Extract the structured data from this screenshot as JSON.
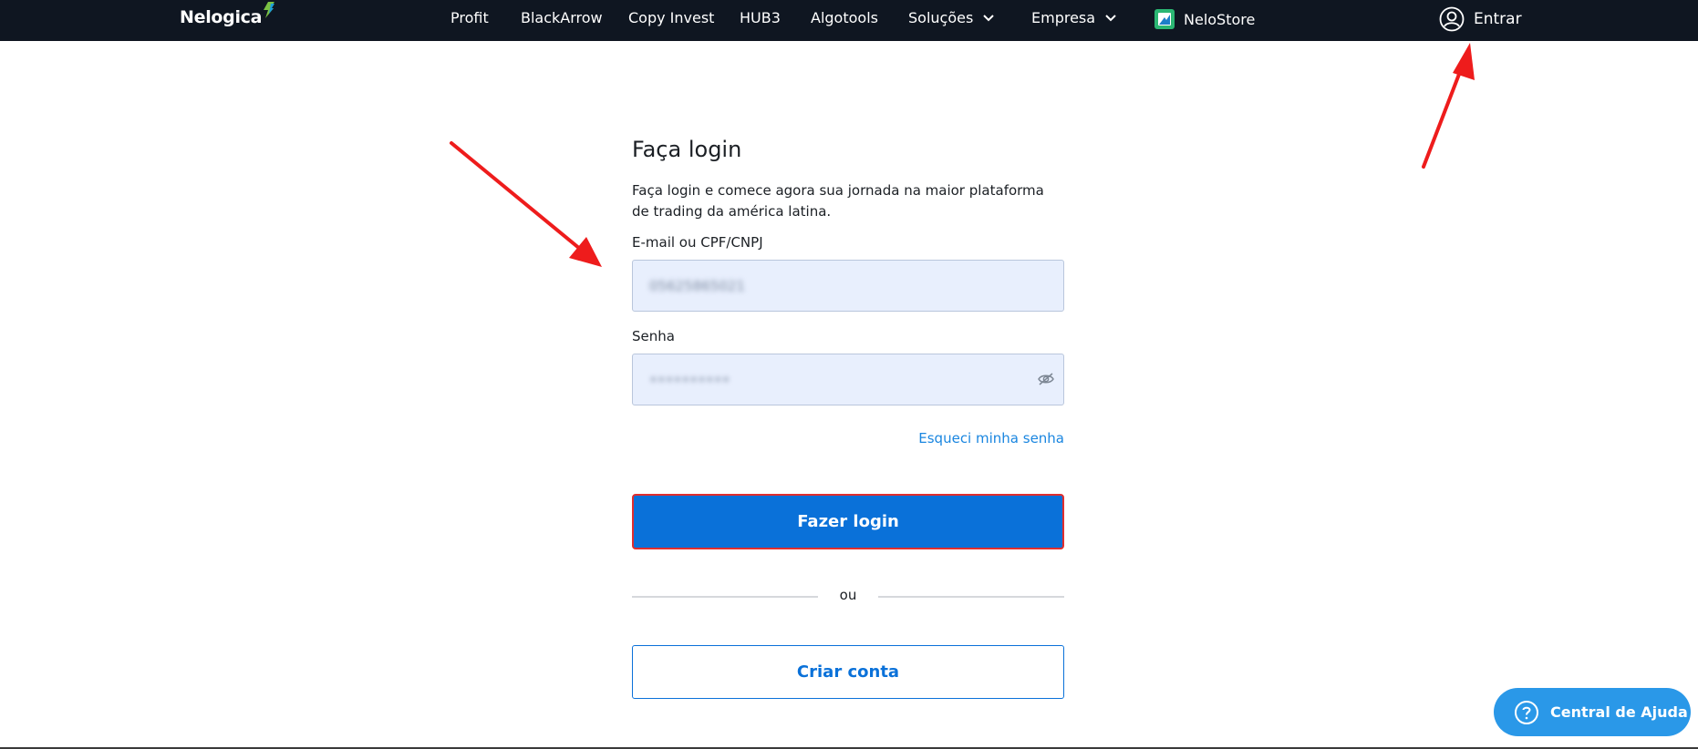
{
  "topbar": {
    "brand": "Nelogica",
    "nav": {
      "profit": "Profit",
      "blackarrow": "BlackArrow",
      "copy_invest": "Copy Invest",
      "hub3": "HUB3",
      "algotools": "Algotools",
      "solucoes": "Soluções",
      "empresa": "Empresa",
      "nelostore": "NeloStore"
    },
    "login_link": "Entrar"
  },
  "login": {
    "title": "Faça login",
    "subtitle": "Faça login e comece agora sua jornada na maior plataforma de trading da américa latina.",
    "email_label": "E-mail ou CPF/CNPJ",
    "email_value": "05625865021",
    "password_label": "Senha",
    "password_value": "••••••••••",
    "forgot_link": "Esqueci minha senha",
    "submit_label": "Fazer login",
    "divider_text": "ou",
    "create_account_label": "Criar conta"
  },
  "help": {
    "label": "Central de Ajuda"
  },
  "colors": {
    "topbar": "#0f1621",
    "primary": "#0a71d9",
    "field_bg": "#e8effd",
    "help": "#2a98e8",
    "annotation_arrow": "#ee1c1c"
  },
  "icons": {
    "brand_mark": "nelogica-bolt-icon",
    "nav_dropdown": "chevron-down-icon",
    "store": "nelostore-icon",
    "user": "user-circle-icon",
    "password_toggle": "eye-off-icon",
    "help": "question-circle-icon"
  }
}
